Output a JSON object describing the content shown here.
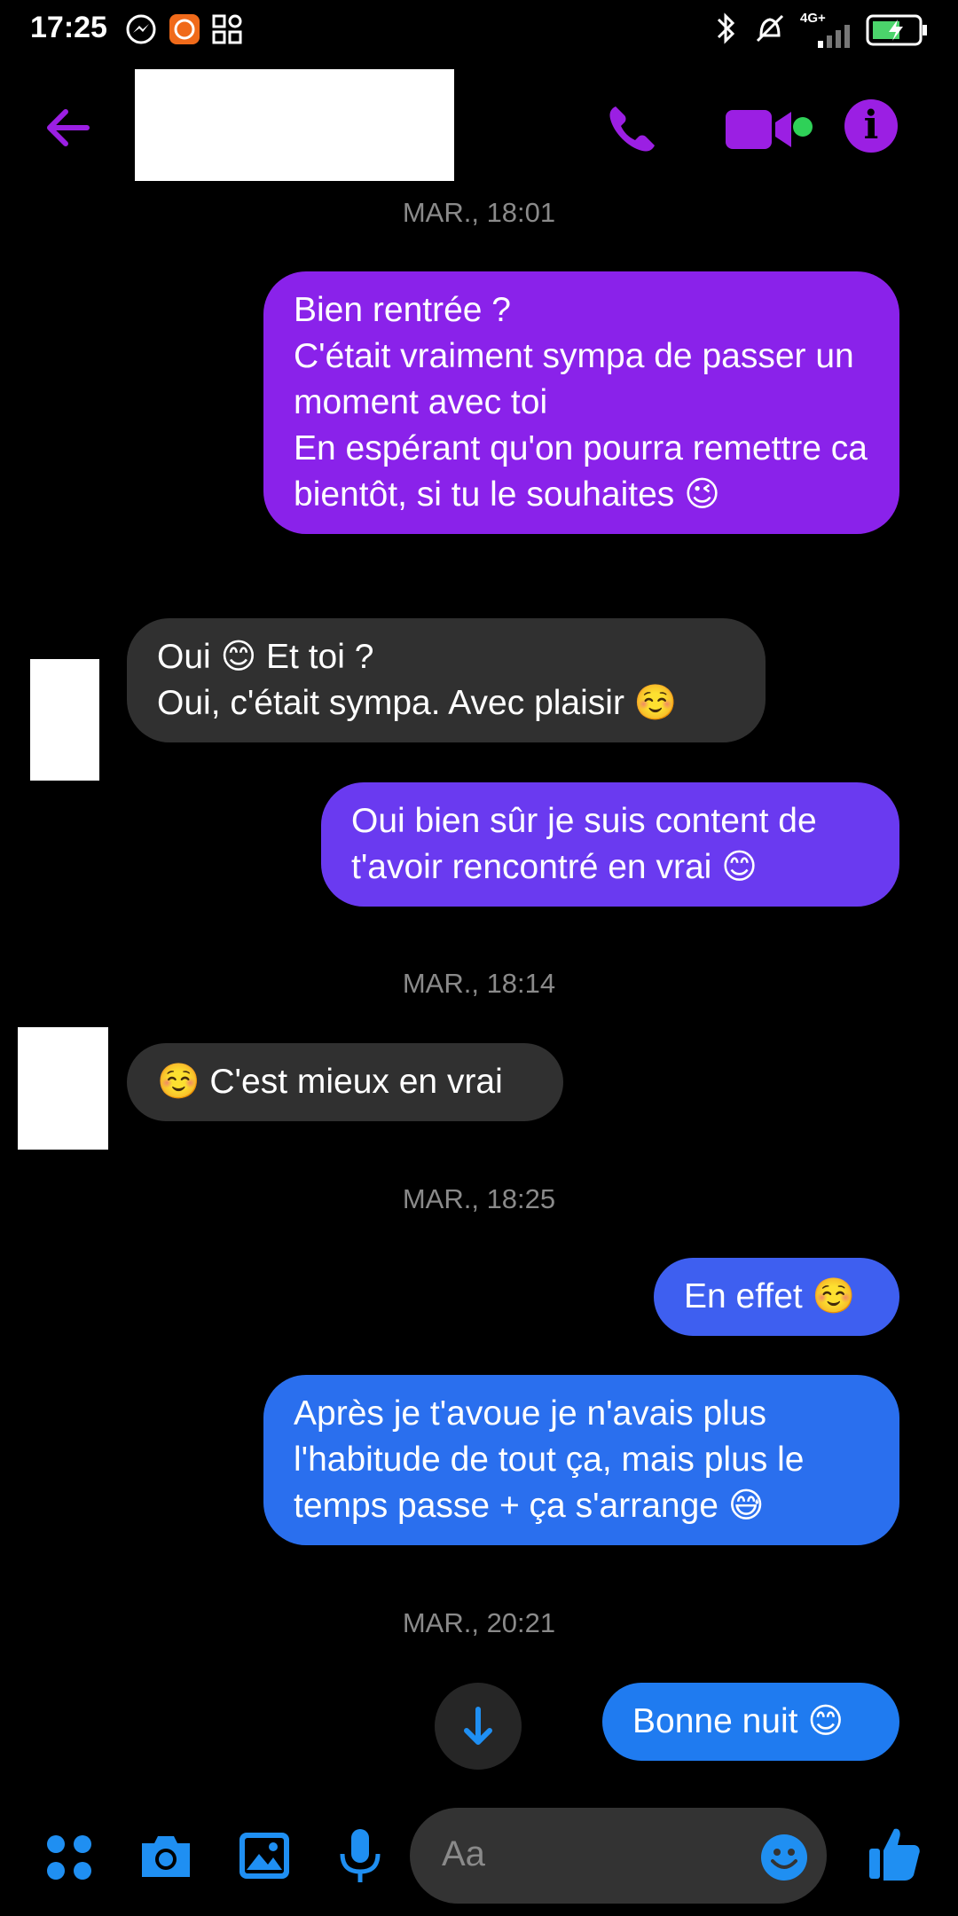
{
  "status_bar": {
    "time": "17:25",
    "network": "4G+"
  },
  "header": {
    "contact_name": ""
  },
  "messages": [
    {
      "type": "timestamp",
      "text": "MAR., 18:01"
    },
    {
      "type": "outgoing",
      "text": "Bien rentrée ?\nC'était vraiment sympa de passer un moment avec toi\nEn espérant qu'on pourra remettre ca bientôt, si tu le souhaites 😉"
    },
    {
      "type": "incoming",
      "text": "Oui 😊 Et toi ?\nOui, c'était sympa. Avec plaisir ☺️"
    },
    {
      "type": "outgoing",
      "text": "Oui bien sûr je suis content de t'avoir rencontré en vrai 😊"
    },
    {
      "type": "timestamp",
      "text": "MAR., 18:14"
    },
    {
      "type": "incoming",
      "text": "☺️ C'est mieux en vrai"
    },
    {
      "type": "timestamp",
      "text": "MAR., 18:25"
    },
    {
      "type": "outgoing",
      "text": "En effet ☺️"
    },
    {
      "type": "outgoing",
      "text": "Après je t'avoue je n'avais plus l'habitude de tout ça, mais plus le temps passe + ça s'arrange 😅"
    },
    {
      "type": "timestamp",
      "text": "MAR., 20:21"
    },
    {
      "type": "outgoing",
      "text": "Bonne nuit 😊"
    }
  ],
  "composer": {
    "placeholder": "Aa"
  },
  "colors": {
    "accent_purple": "#9b1fe3",
    "bubble_1": "#8a22ea",
    "bubble_2": "#6a3af0",
    "bubble_3": "#3e5ff0",
    "bubble_4": "#2a6fee",
    "composer_blue": "#1f8ff2",
    "incoming": "#303030"
  }
}
